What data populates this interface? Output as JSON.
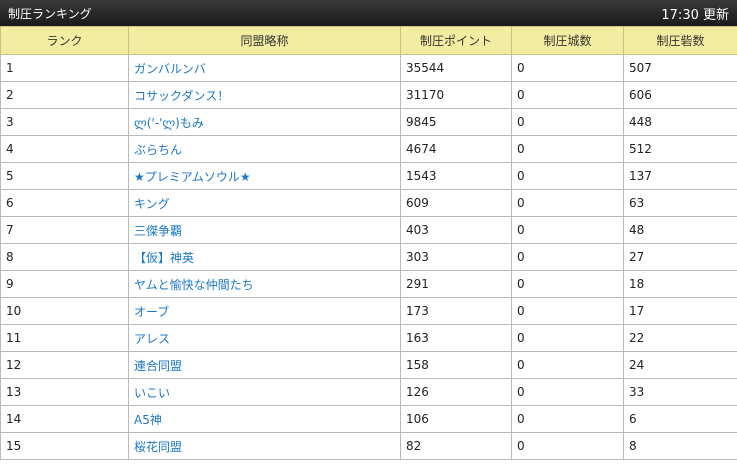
{
  "header": {
    "title": "制圧ランキング",
    "updated": "17:30 更新"
  },
  "columns": [
    "ランク",
    "同盟略称",
    "制圧ポイント",
    "制圧城数",
    "制圧砦数"
  ],
  "rows": [
    {
      "rank": "1",
      "name": "ガンバルンバ",
      "points": "35544",
      "castles": "0",
      "forts": "507"
    },
    {
      "rank": "2",
      "name": "コサックダンス！",
      "points": "31170",
      "castles": "0",
      "forts": "606"
    },
    {
      "rank": "3",
      "name": "ლ('-'ლ)もみ",
      "points": "9845",
      "castles": "0",
      "forts": "448"
    },
    {
      "rank": "4",
      "name": "ぶらちん",
      "points": "4674",
      "castles": "0",
      "forts": "512"
    },
    {
      "rank": "5",
      "name": "★プレミアムソウル★",
      "points": "1543",
      "castles": "0",
      "forts": "137"
    },
    {
      "rank": "6",
      "name": "キング",
      "points": "609",
      "castles": "0",
      "forts": "63"
    },
    {
      "rank": "7",
      "name": "三傑争覇",
      "points": "403",
      "castles": "0",
      "forts": "48"
    },
    {
      "rank": "8",
      "name": "【仮】神英",
      "points": "303",
      "castles": "0",
      "forts": "27"
    },
    {
      "rank": "9",
      "name": "ヤムと愉快な仲間たち",
      "points": "291",
      "castles": "0",
      "forts": "18"
    },
    {
      "rank": "10",
      "name": "オーブ",
      "points": "173",
      "castles": "0",
      "forts": "17"
    },
    {
      "rank": "11",
      "name": "アレス",
      "points": "163",
      "castles": "0",
      "forts": "22"
    },
    {
      "rank": "12",
      "name": "連合同盟",
      "points": "158",
      "castles": "0",
      "forts": "24"
    },
    {
      "rank": "13",
      "name": "いこい",
      "points": "126",
      "castles": "0",
      "forts": "33"
    },
    {
      "rank": "14",
      "name": "A5神",
      "points": "106",
      "castles": "0",
      "forts": "6"
    },
    {
      "rank": "15",
      "name": "桜花同盟",
      "points": "82",
      "castles": "0",
      "forts": "8"
    }
  ]
}
